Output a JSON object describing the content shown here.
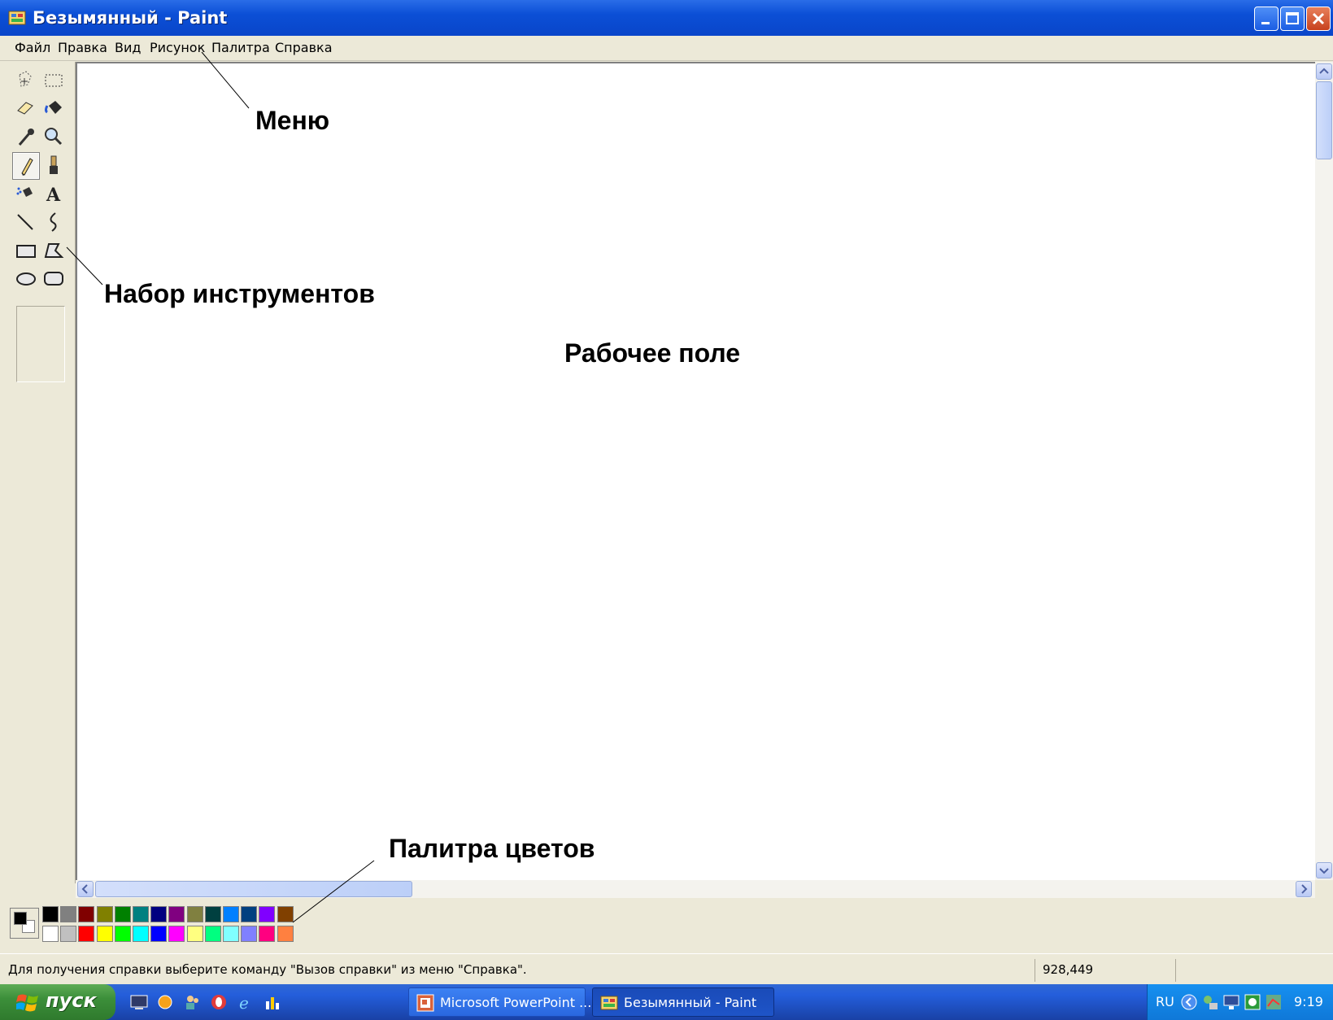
{
  "window": {
    "title": "Безымянный - Paint"
  },
  "menu": {
    "items": [
      "Файл",
      "Правка",
      "Вид",
      "Рисунок",
      "Палитра",
      "Справка"
    ]
  },
  "toolbox": {
    "tools": [
      "free-select-icon",
      "rect-select-icon",
      "eraser-icon",
      "fill-bucket-icon",
      "color-picker-icon",
      "magnifier-icon",
      "pencil-icon",
      "brush-icon",
      "airbrush-icon",
      "text-icon",
      "line-icon",
      "curve-icon",
      "rectangle-icon",
      "polygon-icon",
      "ellipse-icon",
      "rounded-rectangle-icon"
    ],
    "selected": "pencil-icon"
  },
  "annotations": {
    "menu": "Меню",
    "toolbox": "Набор инструментов",
    "canvas": "Рабочее поле",
    "palette": "Палитра цветов"
  },
  "palette": {
    "foreground": "#000000",
    "background": "#ffffff",
    "top_row": [
      "#000000",
      "#808080",
      "#800000",
      "#808000",
      "#008000",
      "#008080",
      "#000080",
      "#800080",
      "#808040",
      "#004040",
      "#0080ff",
      "#004080",
      "#8000ff",
      "#804000"
    ],
    "bottom_row": [
      "#ffffff",
      "#c0c0c0",
      "#ff0000",
      "#ffff00",
      "#00ff00",
      "#00ffff",
      "#0000ff",
      "#ff00ff",
      "#ffff80",
      "#00ff80",
      "#80ffff",
      "#8080ff",
      "#ff0080",
      "#ff8040"
    ]
  },
  "status": {
    "help_text": "Для получения справки выберите команду \"Вызов справки\" из меню \"Справка\".",
    "coords": "928,449"
  },
  "taskbar": {
    "start_label": "пуск",
    "quicklaunch": [
      "desktop-icon",
      "sun-icon",
      "people-icon",
      "opera-icon",
      "ie-icon",
      "chart-icon"
    ],
    "tasks": [
      {
        "label": "Microsoft PowerPoint ...",
        "active": false
      },
      {
        "label": "Безымянный - Paint",
        "active": true
      }
    ],
    "lang": "RU",
    "clock": "9:19"
  }
}
